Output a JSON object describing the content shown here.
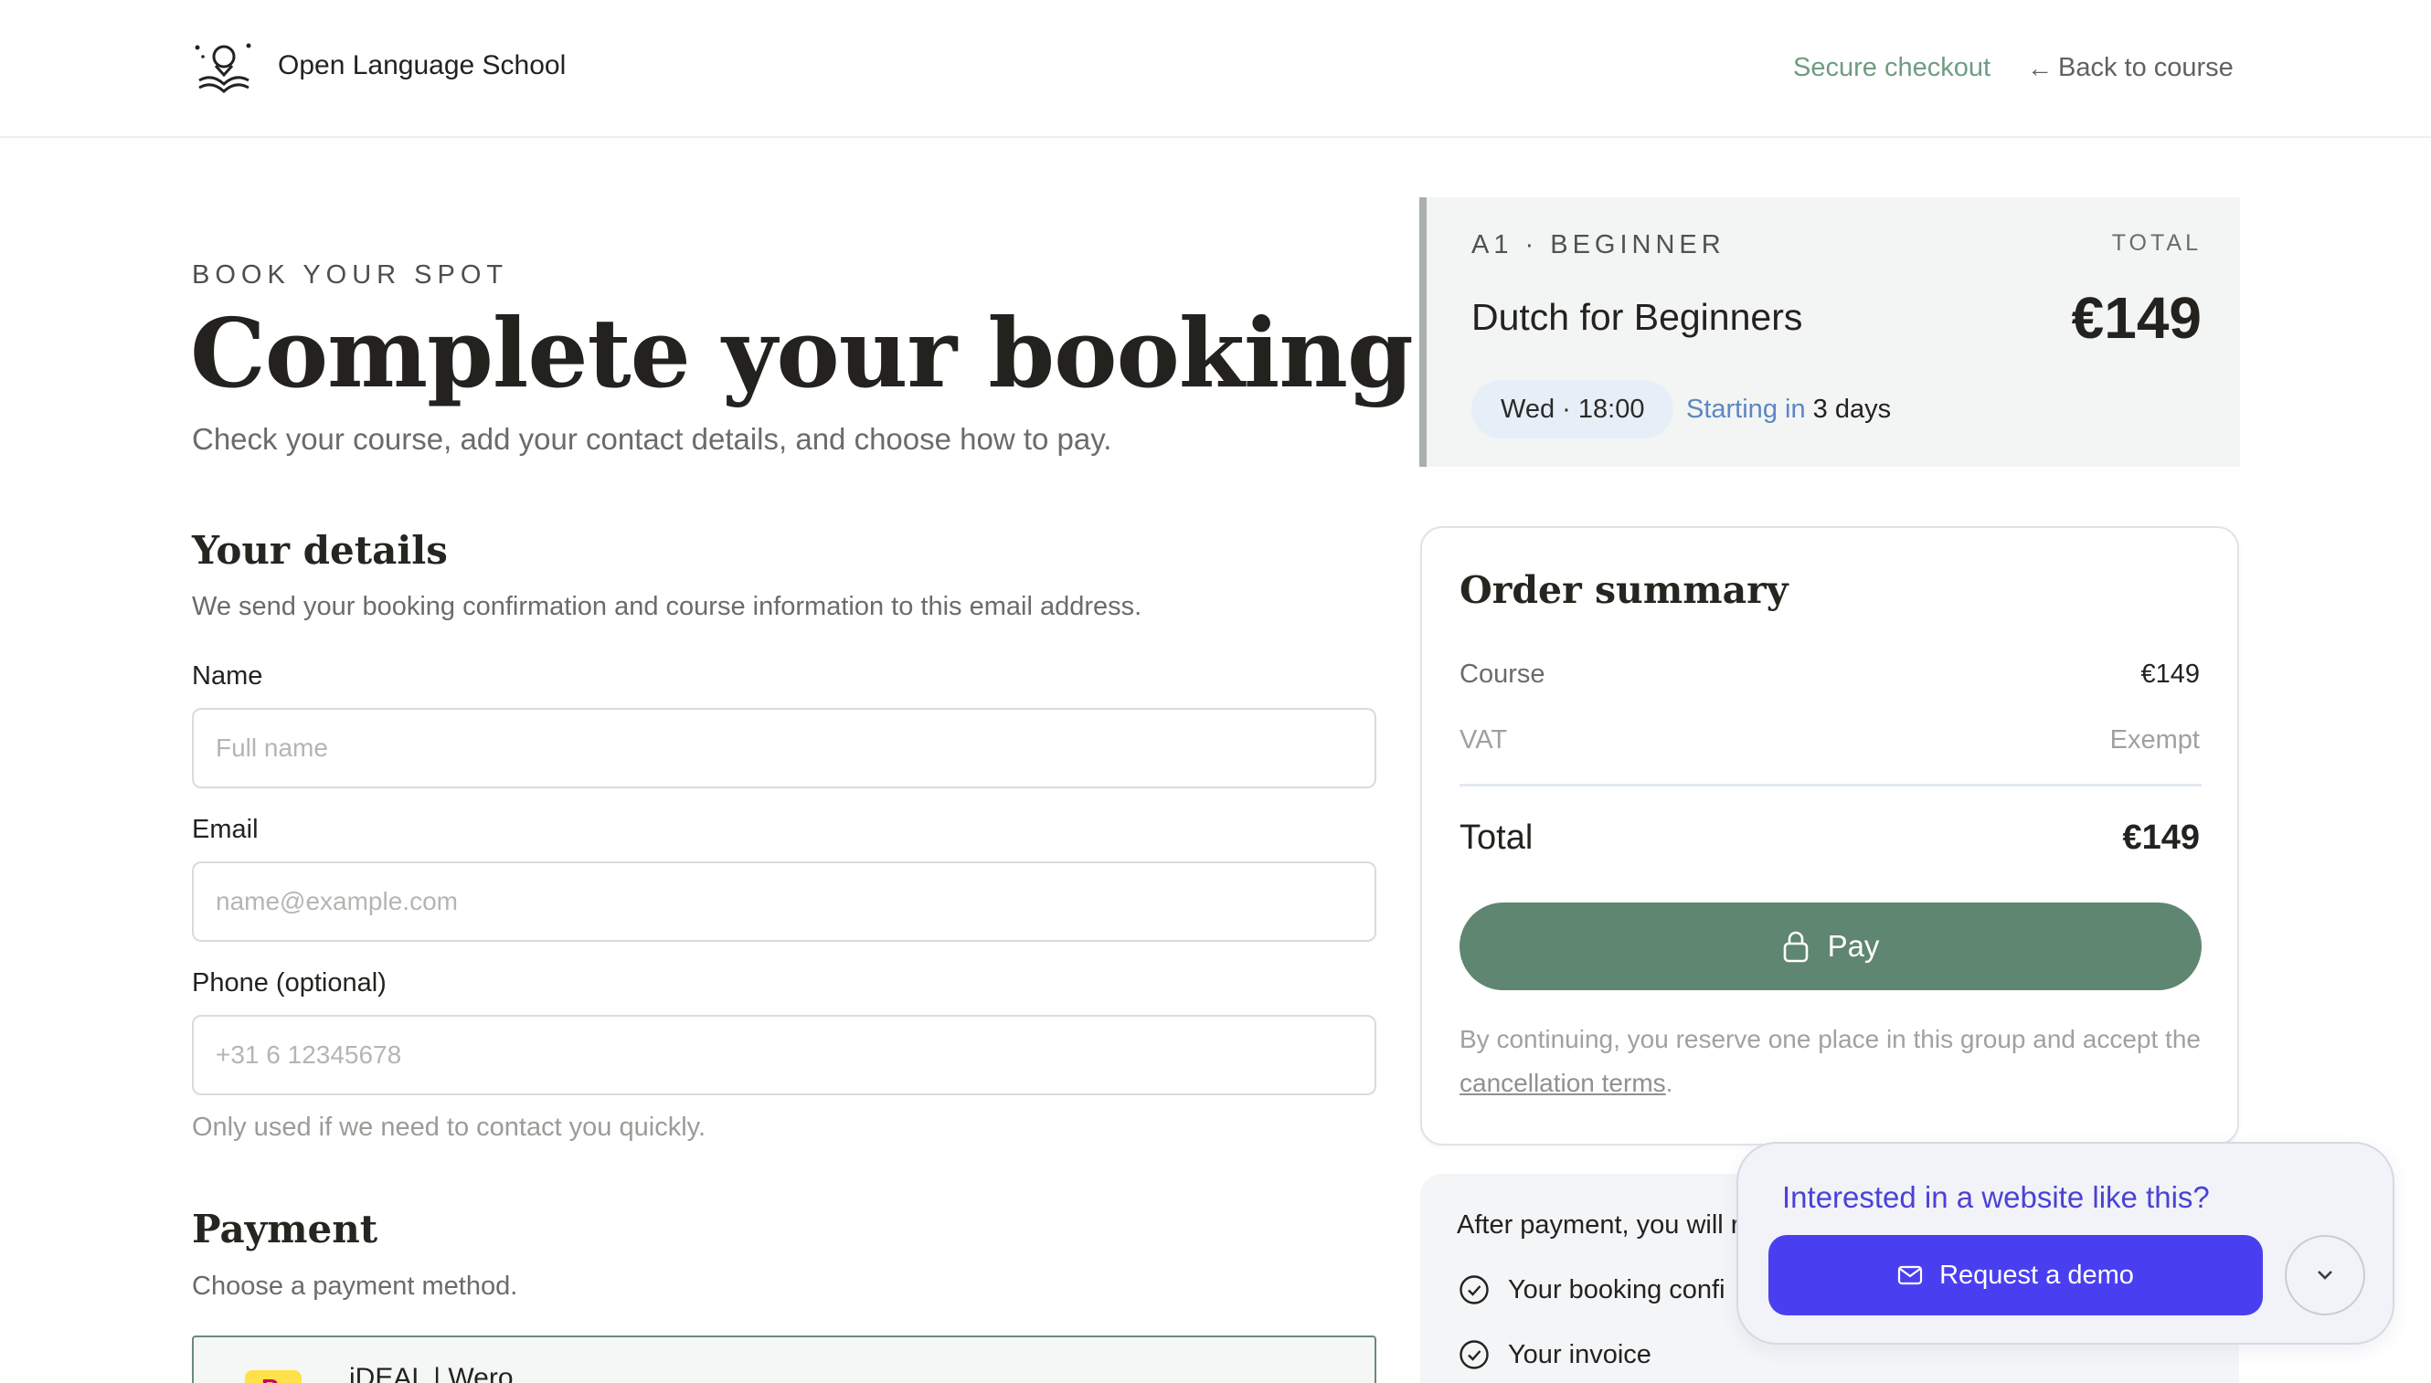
{
  "header": {
    "brand_name": "Open Language School",
    "secure_checkout": "Secure checkout",
    "back_arrow": "←",
    "back_to_course": "Back to course"
  },
  "intro": {
    "eyebrow": "BOOK YOUR SPOT",
    "title": "Complete your booking",
    "subtitle": "Check your course, add your contact details, and choose how to pay."
  },
  "details": {
    "title": "Your details",
    "subtitle": "We send your booking confirmation and course information to this email address.",
    "name_label": "Name",
    "name_placeholder": "Full name",
    "email_label": "Email",
    "email_placeholder": "name@example.com",
    "phone_label": "Phone (optional)",
    "phone_placeholder": "+31 6 12345678",
    "phone_help": "Only used if we need to contact you quickly."
  },
  "payment": {
    "title": "Payment",
    "subtitle": "Choose a payment method.",
    "option_badge": "P",
    "option_name": "iDEAL | Wero"
  },
  "course": {
    "level": "A1 · BEGINNER",
    "total_label": "TOTAL",
    "name": "Dutch for Beginners",
    "price": "€149",
    "schedule": "Wed · 18:00",
    "starting_prefix": "Starting in",
    "starting_value": "3 days"
  },
  "summary": {
    "title": "Order summary",
    "course_label": "Course",
    "course_value": "€149",
    "vat_label": "VAT",
    "vat_value": "Exempt",
    "total_label": "Total",
    "total_value": "€149",
    "pay_label": "Pay",
    "legal_text": "By continuing, you reserve one place in this group and accept the ",
    "legal_link": "cancellation terms",
    "legal_end": "."
  },
  "after_payment": {
    "title": "After payment, you will r",
    "items": [
      "Your booking confi",
      "Your invoice"
    ]
  },
  "demo": {
    "title": "Interested in a website like this?",
    "button_label": "Request a demo"
  }
}
